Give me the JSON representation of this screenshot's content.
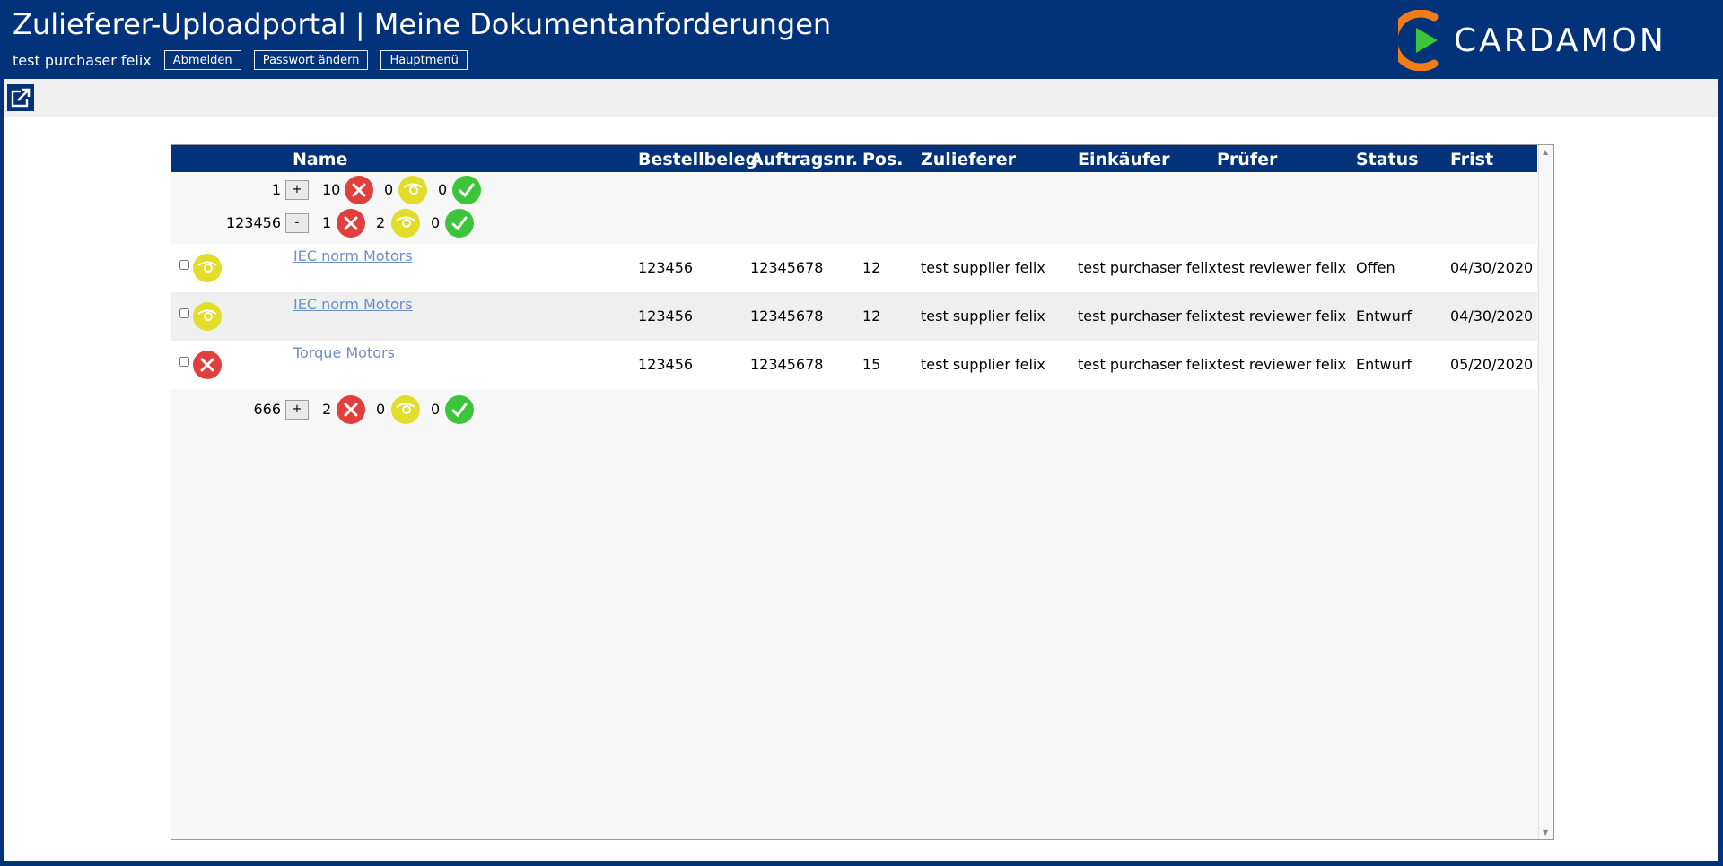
{
  "header": {
    "title": "Zulieferer-Uploadportal | Meine Dokumentanforderungen",
    "user": "test purchaser felix",
    "buttons": {
      "logout": "Abmelden",
      "change_password": "Passwort ändern",
      "main_menu": "Hauptmenü"
    },
    "logo_text": "CARDAMON"
  },
  "toolbar": {
    "external_icon": "external-link-icon"
  },
  "grid": {
    "columns": {
      "name": "Name",
      "bestellbeleg": "Bestellbeleg",
      "auftragsnr": "Auftragsnr.",
      "pos": "Pos.",
      "zulieferer": "Zulieferer",
      "einkaeufer": "Einkäufer",
      "pruefer": "Prüfer",
      "status": "Status",
      "frist": "Frist"
    },
    "groups": [
      {
        "key": "1",
        "toggle": "+",
        "red": "10",
        "yellow": "0",
        "green": "0"
      },
      {
        "key": "123456",
        "toggle": "-",
        "red": "1",
        "yellow": "2",
        "green": "0"
      },
      {
        "key": "666",
        "toggle": "+",
        "red": "2",
        "yellow": "0",
        "green": "0"
      }
    ],
    "rows": [
      {
        "state": "review",
        "name": "IEC norm Motors",
        "bestellbeleg": "123456",
        "auftragsnr": "12345678",
        "pos": "12",
        "zulieferer": "test supplier felix",
        "einkaeufer": "test purchaser felix",
        "pruefer": "test reviewer felix",
        "status": "Offen",
        "frist": "04/30/2020"
      },
      {
        "state": "review",
        "name": "IEC norm Motors",
        "bestellbeleg": "123456",
        "auftragsnr": "12345678",
        "pos": "12",
        "zulieferer": "test supplier felix",
        "einkaeufer": "test purchaser felix",
        "pruefer": "test reviewer felix",
        "status": "Entwurf",
        "frist": "04/30/2020"
      },
      {
        "state": "rejected",
        "name": "Torque Motors",
        "bestellbeleg": "123456",
        "auftragsnr": "12345678",
        "pos": "15",
        "zulieferer": "test supplier felix",
        "einkaeufer": "test purchaser felix",
        "pruefer": "test reviewer felix",
        "status": "Entwurf",
        "frist": "05/20/2020"
      }
    ]
  },
  "colors": {
    "brand_blue": "#02327a",
    "logo_orange": "#f07d1a",
    "logo_green": "#3cc43b",
    "link": "#6a8fc5",
    "red": "#e13e3e",
    "yellow": "#e2dc2a",
    "green": "#3cc43b"
  }
}
